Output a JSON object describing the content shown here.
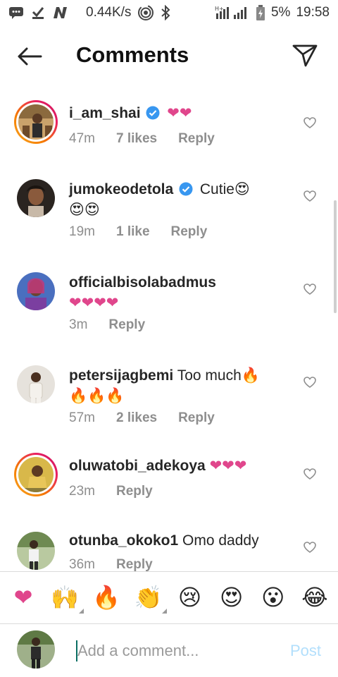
{
  "status_bar": {
    "speed": "0.44K/s",
    "battery": "5%",
    "time": "19:58",
    "network": "H+"
  },
  "header": {
    "title": "Comments"
  },
  "comments": [
    {
      "username": "i_am_shai",
      "verified": true,
      "text": "❤❤",
      "time": "47m",
      "likes": "7 likes",
      "reply": "Reply"
    },
    {
      "username": "jumokeodetola",
      "verified": true,
      "text": "Cutie😍",
      "text2": "😍😍",
      "time": "19m",
      "likes": "1 like",
      "reply": "Reply"
    },
    {
      "username": "officialbisolabadmus",
      "verified": false,
      "text": "",
      "text2": "❤❤❤❤",
      "time": "3m",
      "likes": "",
      "reply": "Reply"
    },
    {
      "username": "petersijagbemi",
      "verified": false,
      "text": "Too much🔥",
      "text2": "🔥🔥🔥",
      "time": "57m",
      "likes": "2 likes",
      "reply": "Reply"
    },
    {
      "username": "oluwatobi_adekoya",
      "verified": false,
      "text": "❤❤❤",
      "time": "23m",
      "likes": "",
      "reply": "Reply"
    },
    {
      "username": "otunba_okoko1",
      "verified": false,
      "text": "Omo daddy",
      "time": "36m",
      "likes": "",
      "reply": "Reply"
    }
  ],
  "emoji_bar": [
    "❤",
    "🙌",
    "🔥",
    "👏",
    "😢",
    "😍",
    "😮",
    "😂"
  ],
  "composer": {
    "placeholder": "Add a comment...",
    "post_label": "Post"
  },
  "colors": {
    "heart": "#e0468c",
    "post_disabled": "#b2dffc",
    "verified": "#3897f0",
    "meta": "#8e8e8e"
  }
}
